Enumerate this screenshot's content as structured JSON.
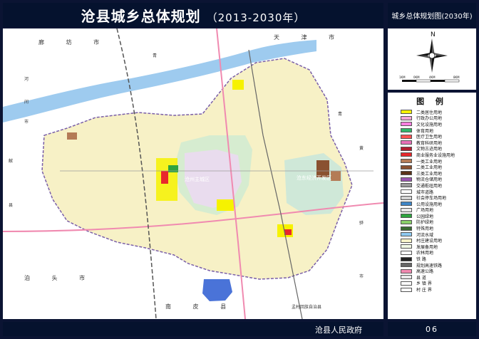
{
  "title": {
    "main": "沧县城乡总体规划",
    "years": "（2013-2030年）"
  },
  "side_header": "城乡总体规划图(2030年)",
  "compass_label": "N",
  "scale_labels": [
    "1KM",
    "0KM",
    "4KM",
    "8KM"
  ],
  "legend": {
    "title": "图 例",
    "items": [
      {
        "label": "二类居住用地",
        "color": "#f6f200"
      },
      {
        "label": "行政办公用地",
        "color": "#f2a6d8"
      },
      {
        "label": "文化设施用地",
        "color": "#ff7fe0"
      },
      {
        "label": "体育用地",
        "color": "#2fb86a"
      },
      {
        "label": "医疗卫生用地",
        "color": "#ff5252"
      },
      {
        "label": "教育科研用地",
        "color": "#e870b8"
      },
      {
        "label": "文物古迹用地",
        "color": "#b01e30"
      },
      {
        "label": "商业服务业设施用地",
        "color": "#e8282c"
      },
      {
        "label": "一类工业用地",
        "color": "#b47b56"
      },
      {
        "label": "二类工业用地",
        "color": "#8a5130"
      },
      {
        "label": "三类工业用地",
        "color": "#5b3318"
      },
      {
        "label": "物流仓储用地",
        "color": "#9a55b0"
      },
      {
        "label": "交通枢纽用地",
        "color": "#9a9a9a"
      },
      {
        "label": "城市道路",
        "color": "#ffffff"
      },
      {
        "label": "社会停车场用地",
        "color": "#d3d3d3"
      },
      {
        "label": "公用设施用地",
        "color": "#3f86c7"
      },
      {
        "label": "广场用地",
        "color": "#e8e8e8"
      },
      {
        "label": "公园绿地",
        "color": "#2ea33f"
      },
      {
        "label": "防护绿地",
        "color": "#8ad06a"
      },
      {
        "label": "特殊用地",
        "color": "#3b6b34"
      },
      {
        "label": "河流水域",
        "color": "#8ec9f0"
      },
      {
        "label": "村庄建设用地",
        "color": "#f7f3c8"
      },
      {
        "label": "发展备用地",
        "color": "#f1f8e4"
      },
      {
        "label": "农林用地",
        "color": "#ffffff"
      },
      {
        "label": "铁 路",
        "color": "#222222"
      },
      {
        "label": "规划高速铁路",
        "color": "#666666"
      },
      {
        "label": "高速公路",
        "color": "#f08ab0"
      },
      {
        "label": "县 道",
        "color": "#e8e8e8"
      },
      {
        "label": "乡 镇 界",
        "color": "#ffffff"
      },
      {
        "label": "村 庄 界",
        "color": "#ffffff"
      }
    ]
  },
  "map_labels": {
    "zhuchengqu": "沧州主城区",
    "kaifaqu": "沧东经济开发区",
    "langfang": "廊 坊 市",
    "qing_a": "青",
    "qing_b": "青",
    "tianjin": "天 津 市",
    "he": "河",
    "jian": "间",
    "shi": "市",
    "xian": "献",
    "xian2": "县",
    "botou": "泊 头 市",
    "nanpi": "南 皮 县",
    "mengcun": "孟村回族自治县",
    "huang": "黄",
    "hua": "骅",
    "shi2": "市"
  },
  "footer": {
    "org": "沧县人民政府",
    "page": "06"
  },
  "colors": {
    "frame_bg": "#0b1433",
    "title_bg": "#05122e",
    "map_base": "#f7f1c6",
    "green_belt": "#d6ecd0",
    "river": "#9ecbef",
    "highway": "#f08ab0",
    "city_core": "#e9dcee"
  }
}
